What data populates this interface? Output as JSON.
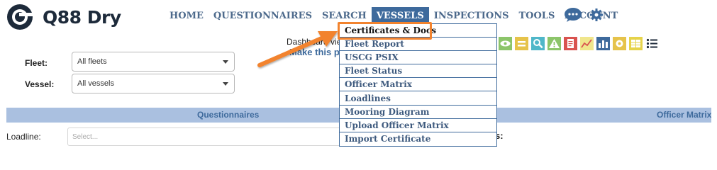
{
  "brand": {
    "name": "Q88 Dry",
    "logo_icon": "q88-logo-icon",
    "color": "#1d2a3a"
  },
  "nav": {
    "items": [
      {
        "label": "HOME",
        "active": false
      },
      {
        "label": "QUESTIONNAIRES",
        "active": false
      },
      {
        "label": "SEARCH",
        "active": false
      },
      {
        "label": "VESSELS",
        "active": true
      },
      {
        "label": "INSPECTIONS",
        "active": false
      },
      {
        "label": "TOOLS",
        "active": false
      },
      {
        "label": "ACCOUNT",
        "active": false
      }
    ],
    "chat_icon": "chat-bubble-icon",
    "settings_icon": "gear-icon",
    "active_color": "#3e6a9c"
  },
  "vessels_menu": {
    "items": [
      "Certificates & Docs",
      "Fleet Report",
      "USCG PSIX",
      "Fleet Status",
      "Officer Matrix",
      "Loadlines",
      "Mooring Diagram",
      "Upload Officer Matrix",
      "Import Certificate"
    ],
    "highlighted_index": 0,
    "highlight_color": "#f2832e"
  },
  "dashboard": {
    "label_visible": "Dashboard vie",
    "link_visible": "Make this p"
  },
  "filters": {
    "fleet": {
      "label": "Fleet:",
      "value": "All fleets"
    },
    "vessel": {
      "label": "Vessel:",
      "value": "All vessels"
    }
  },
  "band": {
    "left_label": "Questionnaires",
    "right_label": "Officer Matrix",
    "color": "#aac0e0"
  },
  "loadline": {
    "label": "Loadline:",
    "placeholder": "Select..."
  },
  "partial_label_colon": "s:",
  "toolbar_icons": [
    "eye-icon",
    "equals-icon",
    "magnifier-icon",
    "warning-icon",
    "document-icon",
    "line-chart-icon",
    "bar-chart-icon",
    "gear-icon",
    "table-icon",
    "list-icon"
  ],
  "annotation": {
    "type": "arrow",
    "color": "#f2832e"
  }
}
